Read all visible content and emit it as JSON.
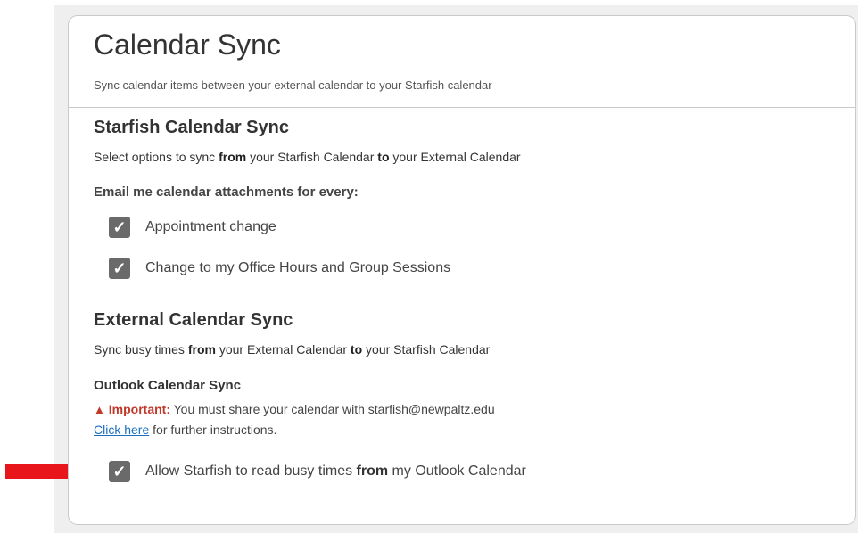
{
  "header": {
    "title": "Calendar Sync",
    "subtitle": "Sync calendar items between your external calendar to your Starfish calendar"
  },
  "starfish_sync": {
    "title": "Starfish Calendar Sync",
    "desc_pre": "Select options to sync ",
    "desc_from": "from",
    "desc_mid": " your Starfish Calendar ",
    "desc_to": "to",
    "desc_post": " your External Calendar",
    "email_label": "Email me calendar attachments for every:",
    "options": [
      {
        "label": "Appointment change",
        "checked": true
      },
      {
        "label": "Change to my Office Hours and Group Sessions",
        "checked": true
      }
    ]
  },
  "external_sync": {
    "title": "External Calendar Sync",
    "desc_pre": "Sync busy times ",
    "desc_from": "from",
    "desc_mid": " your External Calendar ",
    "desc_to": "to",
    "desc_post": " your Starfish Calendar",
    "outlook_title": "Outlook Calendar Sync",
    "important_label": "Important:",
    "important_text": " You must share your calendar with starfish@newpaltz.edu",
    "link_text": "Click here",
    "link_post": " for further instructions.",
    "allow_pre": "Allow Starfish to read busy times ",
    "allow_from": "from",
    "allow_post": " my Outlook Calendar",
    "allow_checked": true
  },
  "icons": {
    "check": "checkmark-icon",
    "warning": "warning-triangle-icon",
    "arrow": "red-right-arrow"
  },
  "colors": {
    "checkbox": "#6a6a6a",
    "warning": "#c0392b",
    "link": "#1a6fbf",
    "arrow": "#e8161b"
  }
}
